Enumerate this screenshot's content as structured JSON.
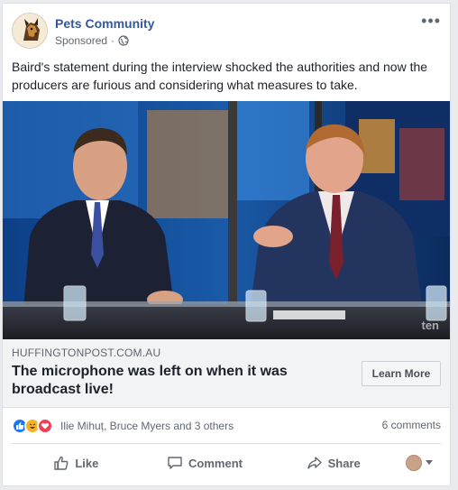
{
  "post": {
    "page_name": "Pets Community",
    "sponsored_label": "Sponsored",
    "body_text": "Baird's statement during the interview shocked the authorities and now the producers are furious and considering what measures to take.",
    "more_icon": "ellipsis-icon"
  },
  "link_preview": {
    "domain": "HUFFINGTONPOST.COM.AU",
    "headline": "The microphone was left on when it was broadcast live!",
    "cta_label": "Learn More",
    "watermark": "ten"
  },
  "engagement": {
    "reactors": "Ilie Mihuț, Bruce Myers and 3 others",
    "comments_count": "6 comments",
    "reaction_types": [
      "like",
      "haha",
      "love"
    ]
  },
  "actions": {
    "like_label": "Like",
    "comment_label": "Comment",
    "share_label": "Share"
  },
  "colors": {
    "link_blue": "#365899",
    "like_blue": "#1877f2",
    "haha_yellow": "#f7b125",
    "love_red": "#f33e58"
  }
}
